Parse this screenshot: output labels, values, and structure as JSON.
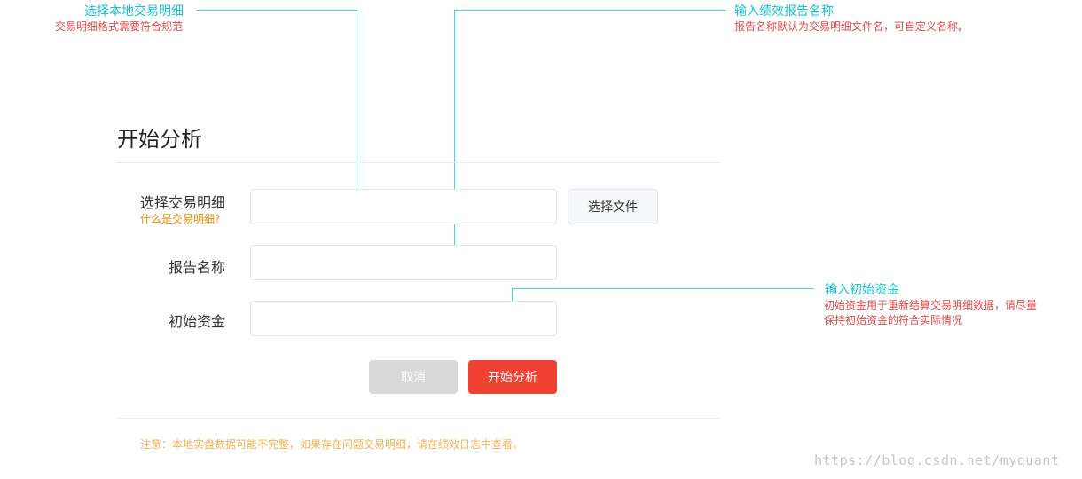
{
  "annotations": {
    "file": {
      "title": "选择本地交易明细",
      "desc": "交易明细格式需要符合规范"
    },
    "report": {
      "title": "输入绩效报告名称",
      "desc": "报告名称默认为交易明细文件名，可自定义名称。"
    },
    "capital": {
      "title": "输入初始资金",
      "desc_line1": "初始资金用于重新结算交易明细数据，请尽量",
      "desc_line2": "保持初始资金的符合实际情况"
    }
  },
  "form": {
    "title": "开始分析",
    "file_label": "选择交易明细",
    "file_help_link": "什么是交易明细?",
    "file_value": "",
    "file_button": "选择文件",
    "report_label": "报告名称",
    "report_value": "",
    "capital_label": "初始资金",
    "capital_value": "",
    "cancel_button": "取消",
    "start_button": "开始分析",
    "notice": "注意：本地实盘数据可能不完整，如果存在问题交易明细，请在绩效日志中查看。"
  },
  "watermark": "https://blog.csdn.net/myquant",
  "colors": {
    "annotation_title": "#17c5d6",
    "annotation_desc": "#e64a4a",
    "callout_line": "#3fd6e0",
    "primary": "#f04132",
    "cancel": "#d9d9d9",
    "notice": "#f2b257",
    "help_link": "#f08c00"
  }
}
